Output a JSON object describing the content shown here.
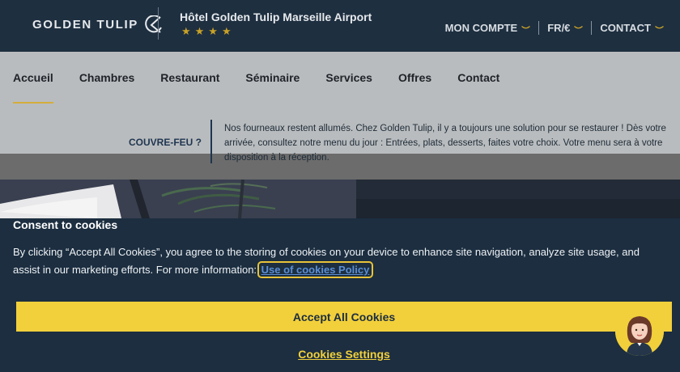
{
  "header": {
    "logo_text": "GOLDEN TULIP",
    "hotel_name": "Hôtel Golden Tulip Marseille Airport",
    "stars": "★★★★",
    "nav": [
      {
        "label": "MON COMPTE"
      },
      {
        "label": "FR/€"
      },
      {
        "label": "CONTACT"
      }
    ]
  },
  "main_nav": {
    "items": [
      {
        "label": "Accueil",
        "active": true
      },
      {
        "label": "Chambres"
      },
      {
        "label": "Restaurant"
      },
      {
        "label": "Séminaire"
      },
      {
        "label": "Services"
      },
      {
        "label": "Offres"
      },
      {
        "label": "Contact"
      }
    ]
  },
  "notice": {
    "label": "COUVRE-FEU ?",
    "text": "Nos fourneaux restent allumés. Chez Golden Tulip, il y a toujours une solution pour se restaurer ! Dès votre arrivée, consultez notre menu du jour : Entrées, plats, desserts, faites votre choix. Votre menu sera à votre disposition à la réception."
  },
  "cookie_banner": {
    "title": "Consent to cookies",
    "text": "By clicking “Accept All Cookies”, you agree to the storing of cookies on your device to enhance site navigation, analyze site usage, and assist in our marketing efforts. For more information:",
    "policy_link": "Use of cookies Policy",
    "accept_label": "Accept All Cookies",
    "settings_label": "Cookies Settings"
  },
  "colors": {
    "header_bg": "#1e2f40",
    "accent_gold": "#d4ad3b",
    "button_yellow": "#f2d03b",
    "link_blue": "#5b8fd6"
  },
  "icons": {
    "logo": "golden-tulip-logo-icon",
    "chevron": "chevron-down-icon",
    "chat": "chat-assistant-avatar-icon"
  }
}
